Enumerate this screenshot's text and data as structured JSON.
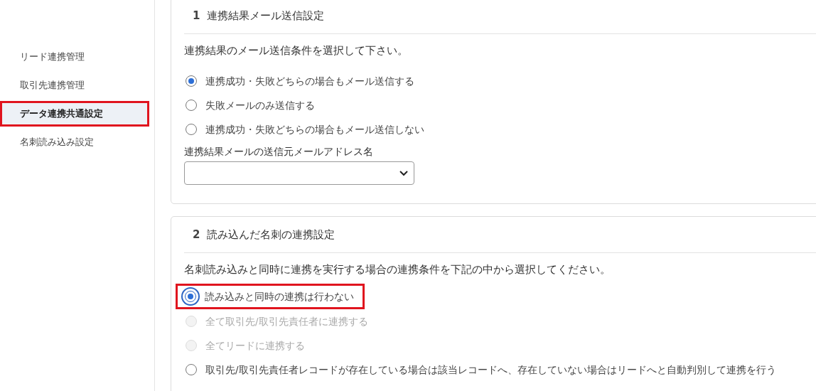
{
  "sidebar": {
    "items": [
      {
        "label": "リード連携管理",
        "selected": false,
        "highlighted": false
      },
      {
        "label": "取引先連携管理",
        "selected": false,
        "highlighted": false
      },
      {
        "label": "データ連携共通設定",
        "selected": true,
        "highlighted": true
      },
      {
        "label": "名刺読み込み設定",
        "selected": false,
        "highlighted": false
      }
    ]
  },
  "sections": [
    {
      "number": "1",
      "title": "連携結果メール送信設定",
      "description": "連携結果のメール送信条件を選択して下さい。",
      "options": [
        {
          "label": "連携成功・失敗どちらの場合もメール送信する",
          "selected": true,
          "disabled": false,
          "highlighted": false
        },
        {
          "label": "失敗メールのみ送信する",
          "selected": false,
          "disabled": false,
          "highlighted": false
        },
        {
          "label": "連携成功・失敗どちらの場合もメール送信しない",
          "selected": false,
          "disabled": false,
          "highlighted": false
        }
      ],
      "fields": [
        {
          "kind": "select",
          "label": "連携結果メールの送信元メールアドレス名"
        }
      ]
    },
    {
      "number": "2",
      "title": "読み込んだ名刺の連携設定",
      "description": "名刺読み込みと同時に連携を実行する場合の連携条件を下記の中から選択してください。",
      "options": [
        {
          "label": "読み込みと同時の連携は行わない",
          "selected": true,
          "disabled": false,
          "highlighted": true
        },
        {
          "label": "全て取引先/取引先責任者に連携する",
          "selected": false,
          "disabled": true,
          "highlighted": false
        },
        {
          "label": "全てリードに連携する",
          "selected": false,
          "disabled": true,
          "highlighted": false
        },
        {
          "label": "取引先/取引先責任者レコードが存在している場合は該当レコードへ、存在していない場合はリードへと自動判別して連携を行う",
          "selected": false,
          "disabled": false,
          "highlighted": false
        }
      ]
    }
  ]
}
